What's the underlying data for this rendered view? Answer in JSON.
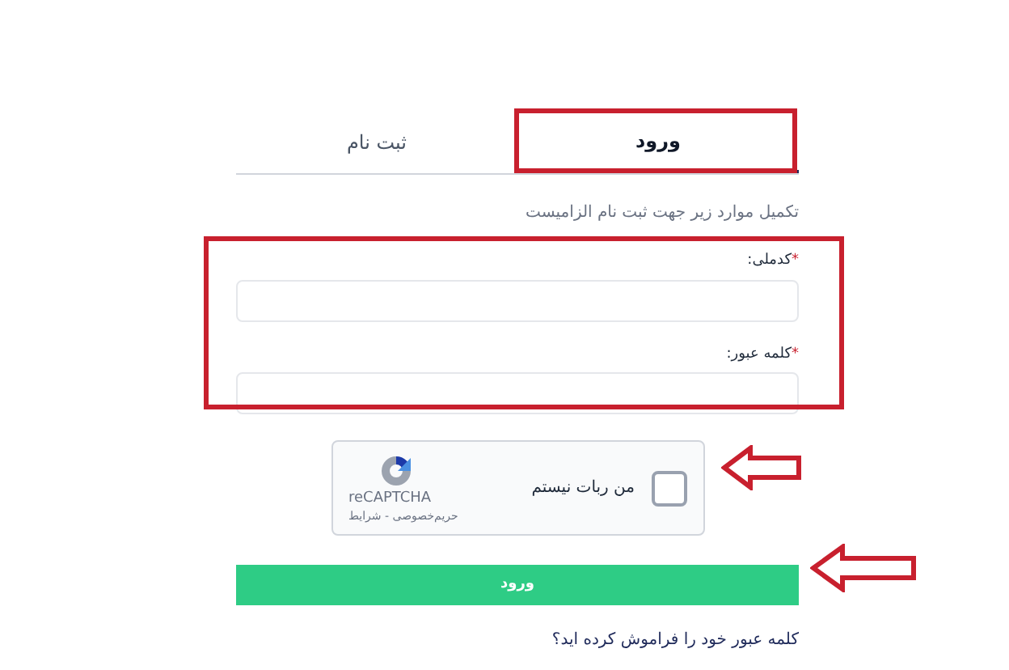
{
  "tabs": [
    {
      "label": "ورود",
      "selected": true
    },
    {
      "label": "ثبت نام",
      "selected": false
    }
  ],
  "subtitle": "تکمیل موارد زیر جهت ثبت نام الزامیست",
  "fields": [
    {
      "required_mark": "*",
      "label": "کدملی:"
    },
    {
      "required_mark": "*",
      "label": "کلمه عبور:"
    }
  ],
  "captcha": {
    "label": "من ربات نیستم",
    "checked": false,
    "brand": "reCAPTCHA",
    "links": "حریم‌خصوصی - شرایط"
  },
  "submit_button": "ورود",
  "forgot_link": "کلمه عبور خود را فراموش کرده اید؟"
}
